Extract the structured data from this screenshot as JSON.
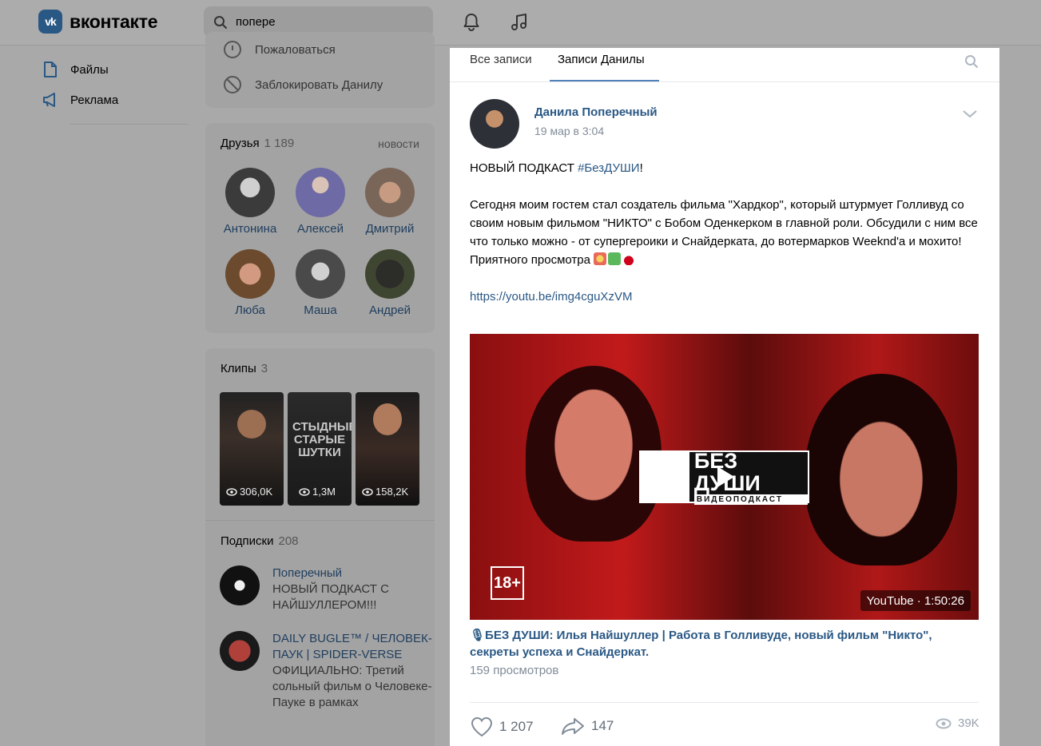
{
  "header": {
    "logo_mark": "vk",
    "logo_text": "вконтакте",
    "search_value": "попере",
    "icons": [
      "search-icon",
      "bell-icon",
      "music-icon"
    ]
  },
  "nav": {
    "items": [
      {
        "label": "Файлы",
        "icon": "file-icon"
      },
      {
        "label": "Реклама",
        "icon": "megaphone-icon"
      }
    ]
  },
  "profile_actions": {
    "report": "Пожаловаться",
    "block": "Заблокировать Данилу"
  },
  "friends": {
    "title": "Друзья",
    "count": "1 189",
    "link": "новости",
    "list": [
      {
        "name": "Антонина"
      },
      {
        "name": "Алексей"
      },
      {
        "name": "Дмитрий"
      },
      {
        "name": "Люба"
      },
      {
        "name": "Маша"
      },
      {
        "name": "Андрей"
      }
    ]
  },
  "clips": {
    "title": "Клипы",
    "count": "3",
    "items": [
      {
        "views": "306,0K",
        "caption": ""
      },
      {
        "views": "1,3M",
        "caption": "СТЫДНЫЕ СТАРЫЕ ШУТКИ"
      },
      {
        "views": "158,2K",
        "caption": ""
      }
    ]
  },
  "subscriptions": {
    "title": "Подписки",
    "count": "208",
    "items": [
      {
        "name": "Поперечный",
        "desc": "НОВЫЙ ПОДКАСТ С НАЙШУЛЛЕРОМ!!!"
      },
      {
        "name": "DAILY BUGLE™ / ЧЕЛОВЕК-ПАУК | SPIDER-VERSE",
        "desc": "ОФИЦИАЛЬНО: Третий сольный фильм о Человеке-Пауке в рамках"
      }
    ]
  },
  "wall": {
    "tabs": [
      "Все записи",
      "Записи Данилы"
    ],
    "active_tab": "Записи Данилы"
  },
  "post": {
    "author": "Данила Поперечный",
    "date": "19 мар в 3:04",
    "line1_prefix": "НОВЫЙ ПОДКАСТ ",
    "hashtag": "#БезДУШИ",
    "line1_suffix": "!",
    "paragraph": "Сегодня моим гостем стал создатель фильма \"Хардкор\", который штурмует Голливуд со своим новым фильмом \"НИКТО\" с Бобом Оденкерком в главной роли. Обсудили с ним все что только можно - от супергероики и Снайдерката, до вотермарков Weeknd'a и мохито!",
    "closing": "Приятного просмотра",
    "link": "https://youtu.be/img4cguXzVM",
    "video": {
      "brand_line1": "БЕЗ ДУШИ",
      "brand_line2": "ВИДЕОПОДКАСТ",
      "age": "18+",
      "source": "YouTube · 1:50:26",
      "title": "🎙БЕЗ ДУШИ: Илья Найшуллер | Работа в Голливуде, новый фильм \"Никто\", секреты успеха и Снайдеркат.",
      "views": "159 просмотров"
    },
    "likes": "1 207",
    "shares": "147",
    "views": "39K"
  },
  "colors": {
    "link": "#2a5885",
    "muted": "#818c99",
    "overlay": "#a9a9a9"
  }
}
